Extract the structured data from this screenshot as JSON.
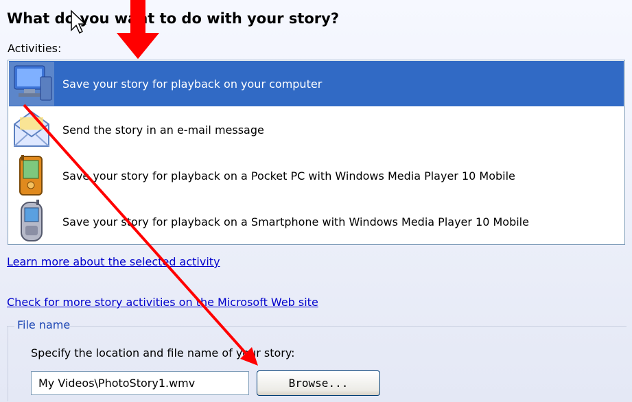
{
  "heading": "What do you want to do with your story?",
  "activities_label": "Activities:",
  "activities": [
    {
      "label": "Save your story for playback on your computer",
      "icon": "computer-icon",
      "selected": true
    },
    {
      "label": "Send the story in an e-mail message",
      "icon": "email-envelope-icon",
      "selected": false
    },
    {
      "label": "Save your story for playback on a Pocket PC with Windows Media Player 10 Mobile",
      "icon": "pocket-pc-icon",
      "selected": false
    },
    {
      "label": "Save your story for playback on a Smartphone with Windows Media Player 10 Mobile",
      "icon": "smartphone-icon",
      "selected": false
    }
  ],
  "links": {
    "learn_more": "Learn more about the selected activity",
    "check_more": "Check for more story activities on the Microsoft Web site"
  },
  "file_section": {
    "legend": "File name",
    "instruction": "Specify the location and file name of your story:",
    "path_value": "My Videos\\PhotoStory1.wmv",
    "browse_label": "Browse..."
  },
  "colors": {
    "selection": "#316ac5",
    "link": "#0000cc",
    "annotation_arrow": "#ff0000"
  }
}
